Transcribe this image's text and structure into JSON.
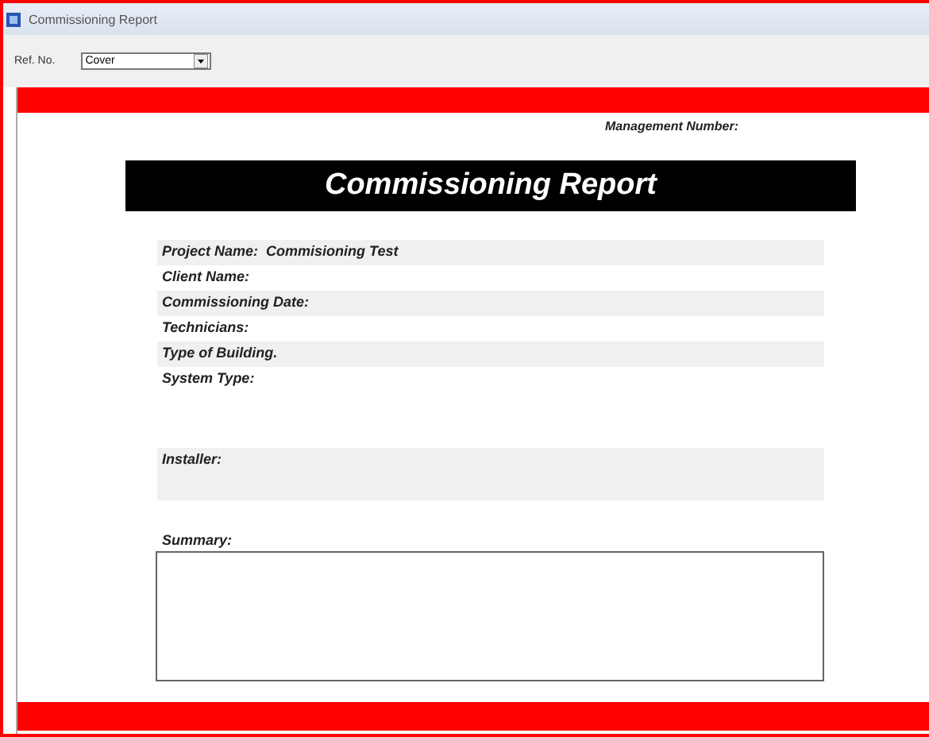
{
  "window": {
    "title": "Commissioning Report"
  },
  "toolbar": {
    "label": "Ref. No.",
    "select": {
      "value": "Cover"
    }
  },
  "report": {
    "management_label": "Management Number:",
    "title": "Commissioning Report",
    "fields": [
      {
        "label": "Project Name:",
        "value": "Commisioning Test",
        "kind": "line",
        "shaded": true
      },
      {
        "label": "Client Name:",
        "kind": "line",
        "shaded": false
      },
      {
        "label": "Commissioning Date:",
        "kind": "line",
        "shaded": true
      },
      {
        "label": "Technicians:",
        "kind": "line",
        "shaded": false
      },
      {
        "label": "Type of Building.",
        "kind": "line",
        "shaded": true
      },
      {
        "label": "System Type:",
        "kind": "spaced",
        "shaded": false
      },
      {
        "label": "Installer:",
        "kind": "block",
        "shaded": true
      }
    ],
    "summary": {
      "label": "Summary:"
    }
  }
}
